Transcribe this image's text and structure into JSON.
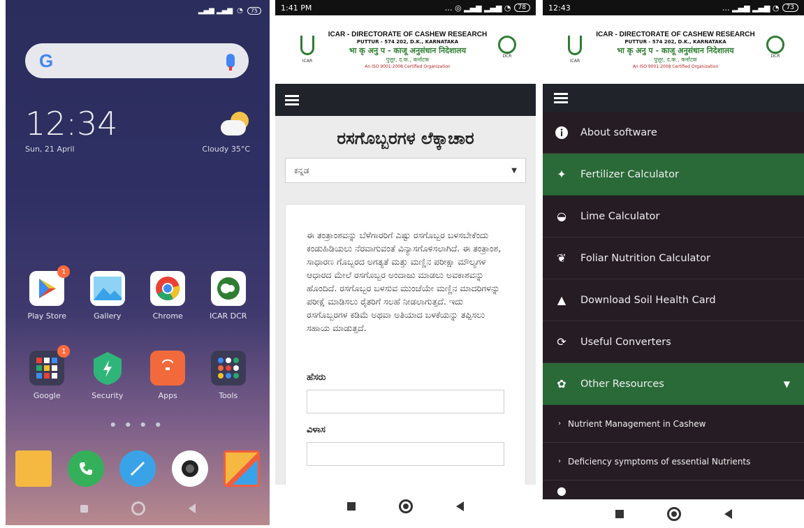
{
  "phone1": {
    "battery": "75",
    "search_logo": "G",
    "clock": "12:34",
    "date": "Sun, 21 April",
    "weather": "Cloudy  35°C",
    "apps_row1": [
      {
        "label": "Play Store",
        "badge": "1",
        "color": "#ffffff"
      },
      {
        "label": "Gallery",
        "badge": "",
        "color": "#6ec6f0"
      },
      {
        "label": "Chrome",
        "badge": "",
        "color": "#ffffff"
      },
      {
        "label": "ICAR DCR",
        "badge": "",
        "color": "#ffffff"
      }
    ],
    "apps_row2": [
      {
        "label": "Google",
        "badge": "1",
        "color": "#3b3b55"
      },
      {
        "label": "Security",
        "badge": "",
        "color": "#2fb57a"
      },
      {
        "label": "Apps",
        "badge": "",
        "color": "#f26a3c"
      },
      {
        "label": "Tools",
        "badge": "",
        "color": "#3b3b55"
      }
    ],
    "dock_colors": [
      "#f5b942",
      "#34b05a",
      "#3aa3e8",
      "#ffffff",
      "#f25e3c"
    ]
  },
  "phone2": {
    "time": "1:41 PM",
    "battery": "78",
    "header": {
      "line1": "ICAR - DIRECTORATE OF CASHEW RESEARCH",
      "line2": "PUTTUR - 574 202, D.K., KARNATAKA",
      "line3": "भा कृ अनु प - काजू अनुसंधान निदेशालय",
      "line4": "पुत्तूर, द.क., कर्नाटक",
      "line5": "An ISO 9001:2008 Certified Organization",
      "logo_left_label": "ICAR",
      "logo_right_label": "DCR"
    },
    "title": "ರಸಗೊಬ್ಬರಗಳ ಲೆಕ್ಕಾಚಾರ",
    "language_select": "ಕನ್ನಡ",
    "description": "ಈ ತಂತ್ರಾಂಶವನ್ನು ಬೆಳೆಗಾರರಿಗೆ ಎಷ್ಟು ರಸಗೊಬ್ಬರ ಬಳಸಬೇಕೆಂದು ಕಂಡುಹಿಡಿಯಲು ನೆರವಾಗುವಂತೆ ವಿನ್ಯಾಸಗೊಳಿಸಲಾಗಿದೆ. ಈ ತಂತ್ರಾಂಶ, ಸಾಧಾರಣ ಗೊಬ್ಬರದ ಅಗತ್ಯತೆ ಮತ್ತು ಮಣ್ಣಿನ ಪರೀಕ್ಷಾ ಮೌಲ್ಯಗಳ ಆಧಾರದ ಮೇಲೆ ರಸಗೊಬ್ಬರ ಅಂದಾಜು ಮಾಡಲು ಅವಕಾಶವನ್ನು ಹೊಂದಿದೆ. ರಸಗೊಬ್ಬರ ಬಳಸುವ ಮುಂಚೆಯೇ ಮಣ್ಣಿನ ಮಾದರಿಗಳನ್ನು ಪರೀಕ್ಷೆ ಮಾಡಿಸಲು ರೈತರಿಗೆ ಸಲಹೆ ನೀಡಲಾಗುತ್ತದೆ. ಇದು ರಸಗೊಬ್ಬರಗಳ ಕಡಿಮೆ ಅಥವಾ ಅತಿಯಾದ ಬಳಕೆಯನ್ನು ತಪ್ಪಿಸಲು ಸಹಾಯ ಮಾಡುತ್ತದೆ.",
    "field_name_label": "ಹೆಸರು",
    "field_address_label": "ವಿಳಾಸ"
  },
  "phone3": {
    "time": "12:43",
    "battery": "73",
    "menu": [
      {
        "label": "About software",
        "icon": "info-icon",
        "glyph": "i",
        "active": false
      },
      {
        "label": "Fertilizer Calculator",
        "icon": "fertilizer-icon",
        "glyph": "✦",
        "active": true
      },
      {
        "label": "Lime Calculator",
        "icon": "lime-icon",
        "glyph": "◒",
        "active": false
      },
      {
        "label": "Foliar Nutrition Calculator",
        "icon": "leaf-icon",
        "glyph": "❦",
        "active": false
      },
      {
        "label": "Download Soil Health Card",
        "icon": "soil-card-icon",
        "glyph": "▲",
        "active": false
      },
      {
        "label": "Useful Converters",
        "icon": "refresh-icon",
        "glyph": "⟳",
        "active": false
      },
      {
        "label": "Other Resources",
        "icon": "resources-icon",
        "glyph": "✿",
        "active": true
      }
    ],
    "submenu": [
      "Nutrient Management in Cashew",
      "Deficiency symptoms of essential Nutrients"
    ],
    "colors": {
      "active": "#2a6a38",
      "menu_bg": "#261c23"
    }
  }
}
